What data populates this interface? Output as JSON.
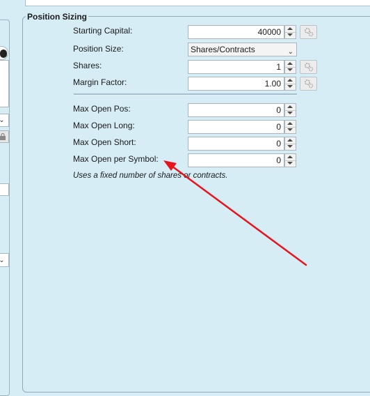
{
  "group": {
    "title": "Position Sizing"
  },
  "fields": {
    "starting_capital": {
      "label": "Starting Capital:",
      "value": "40000"
    },
    "position_size": {
      "label": "Position Size:",
      "value": "Shares/Contracts"
    },
    "shares": {
      "label": "Shares:",
      "value": "1"
    },
    "margin_factor": {
      "label": "Margin Factor:",
      "value": "1.00"
    },
    "max_open_pos": {
      "label": "Max Open Pos:",
      "value": "0"
    },
    "max_open_long": {
      "label": "Max Open Long:",
      "value": "0"
    },
    "max_open_short": {
      "label": "Max Open Short:",
      "value": "0"
    },
    "max_open_per_symbol": {
      "label": "Max Open per Symbol:",
      "value": "0"
    }
  },
  "hint": "Uses a fixed number of shares or contracts.",
  "icons": {
    "gear": "gear-icon",
    "spin_up": "chevron-up-icon",
    "spin_down": "chevron-down-icon"
  },
  "colors": {
    "background": "#d6edf6",
    "annotation_arrow": "#e8131b"
  }
}
